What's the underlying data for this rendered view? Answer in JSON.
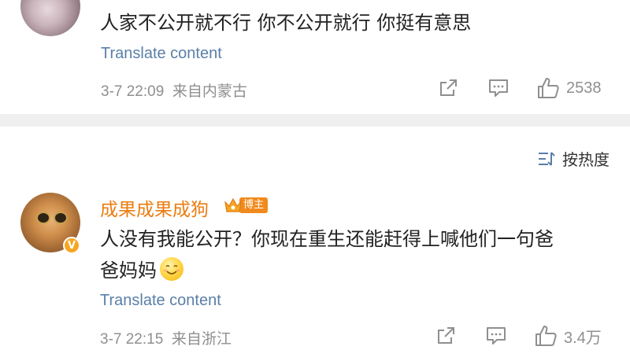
{
  "comments": [
    {
      "text": "人家不公开就不行  你不公开就行  你挺有意思",
      "translate": "Translate content",
      "timestamp": "3-7 22:09",
      "location": "来自内蒙古",
      "likes": "2538"
    },
    {
      "username": "成果成果成狗",
      "badge": "博主",
      "verify": "V",
      "text_line1": "人没有我能公开？你现在重生还能赶得上喊他们一句爸",
      "text_line2": "爸妈妈",
      "translate": "Translate content",
      "timestamp": "3-7 22:15",
      "location": "来自浙江",
      "likes": "3.4万"
    }
  ],
  "sort": {
    "label": "按热度",
    "icon": "sort-icon"
  },
  "colors": {
    "username": "#ea7d12",
    "link": "#5a7fa8",
    "meta": "#8f8f8f",
    "divider": "#efefef"
  }
}
